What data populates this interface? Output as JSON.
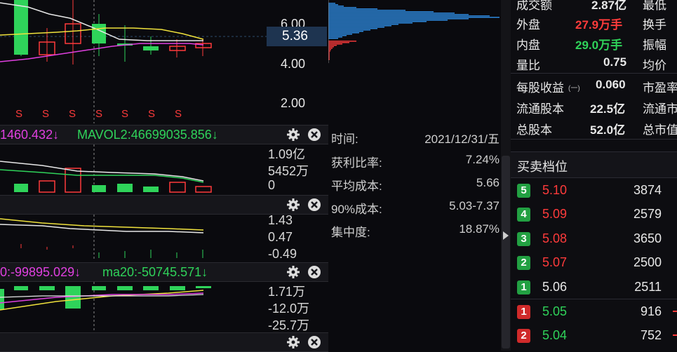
{
  "price_axis": {
    "ticks": [
      "6.00",
      "4.00",
      "2.00"
    ],
    "current": "5.36"
  },
  "s_marker": "S",
  "volume_panel": {
    "label_a": "1460.432↓",
    "label_b": "MAVOL2:46699035.856↓",
    "axis": [
      "1.09亿",
      "5452万",
      "0"
    ]
  },
  "macd_panel": {
    "axis": [
      "1.43",
      "0.47",
      "-0.49"
    ]
  },
  "money_panel": {
    "label_a": "0:-99895.029↓",
    "label_b": "ma20:-50745.571↓",
    "axis": [
      "1.71万",
      "-12.0万",
      "-25.7万"
    ]
  },
  "chip_info": [
    {
      "key": "时间:",
      "value": "2021/12/31/五"
    },
    {
      "key": "获利比率:",
      "value": "7.24%"
    },
    {
      "key": "平均成本:",
      "value": "5.66"
    },
    {
      "key": "90%成本:",
      "value": "5.03-7.37"
    },
    {
      "key": "集中度:",
      "value": "18.87%"
    }
  ],
  "quote": {
    "top": [
      {
        "l": "成交额",
        "v": "2.87亿",
        "r": "最低"
      },
      {
        "l": "外盘",
        "v": "27.9万手",
        "r": "换手"
      },
      {
        "l": "内盘",
        "v": "29.0万手",
        "r": "振幅"
      },
      {
        "l": "量比",
        "v": "0.75",
        "r": "均价"
      }
    ],
    "fin": [
      {
        "l": "每股收益",
        "sub": "(一)",
        "v": "0.060",
        "r": "市盈率"
      },
      {
        "l": "流通股本",
        "v": "22.5亿",
        "r": "流通市"
      },
      {
        "l": "总股本",
        "v": "52.0亿",
        "r": "总市值"
      }
    ]
  },
  "orderbook": {
    "title": "买卖档位",
    "sell": [
      {
        "n": "5",
        "p": "5.10",
        "v": "3874"
      },
      {
        "n": "4",
        "p": "5.09",
        "v": "2579"
      },
      {
        "n": "3",
        "p": "5.08",
        "v": "3650"
      },
      {
        "n": "2",
        "p": "5.07",
        "v": "2500"
      },
      {
        "n": "1",
        "p": "5.06",
        "v": "2511"
      }
    ],
    "buy": [
      {
        "n": "1",
        "p": "5.05",
        "v": "916"
      },
      {
        "n": "2",
        "p": "5.04",
        "v": "752"
      }
    ]
  },
  "colors": {
    "up": "#ff3b3b",
    "down": "#2fd35a",
    "yellow": "#f0e23c",
    "magenta": "#e040e0",
    "white": "#e8e8e8",
    "blue": "#2f8fe8"
  }
}
